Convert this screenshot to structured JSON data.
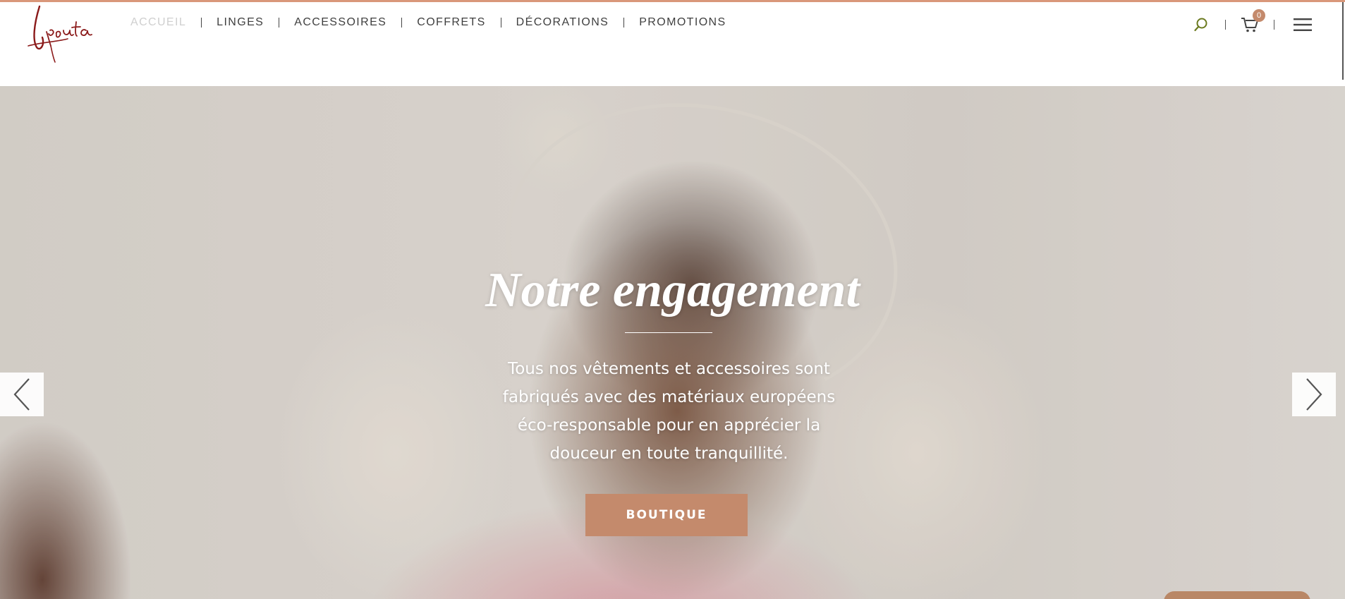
{
  "brand": {
    "logo_text": "Lipouta",
    "logo_color": "#8b1a1a"
  },
  "nav": {
    "items": [
      {
        "label": "ACCUEIL",
        "active": true
      },
      {
        "label": "LINGES",
        "active": false
      },
      {
        "label": "ACCESSOIRES",
        "active": false
      },
      {
        "label": "COFFRETS",
        "active": false
      },
      {
        "label": "DÉCORATIONS",
        "active": false
      },
      {
        "label": "PROMOTIONS",
        "active": false
      }
    ]
  },
  "tools": {
    "search_icon": "search-icon",
    "cart_icon": "cart-icon",
    "cart_count": "0",
    "menu_icon": "hamburger-icon"
  },
  "hero": {
    "title": "Notre engagement",
    "text": "Tous nos vêtements et accessoires sont fabriqués avec des matériaux européens éco-responsable pour en apprécier la douceur en toute tranquillité.",
    "button_label": "BOUTIQUE",
    "prev_icon": "chevron-left-icon",
    "next_icon": "chevron-right-icon"
  },
  "colors": {
    "accent": "#c48a6c",
    "top_bar": "#d9977a",
    "nav_text": "#3f3f3f",
    "nav_active": "#cfcfcf",
    "search_icon": "#6b7a1f"
  }
}
